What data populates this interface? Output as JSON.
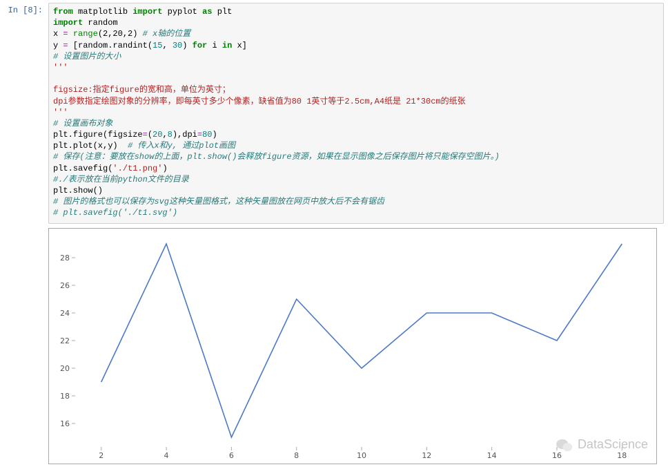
{
  "cell": {
    "prompt": "In  [8]:",
    "code": {
      "l1": {
        "from": "from",
        "mod1": "matplotlib",
        "imp": "import",
        "mod2": "pyplot",
        "as": "as",
        "alias": "plt"
      },
      "l2": {
        "imp": "import",
        "mod": "random"
      },
      "l3": {
        "lhs": "x ",
        "eq": "=",
        "sp": " ",
        "rng": "range",
        "args": "(2,20,2) ",
        "cmt": "# x轴的位置"
      },
      "l4": {
        "lhs": "y ",
        "eq": "=",
        "sp": " [random.randint(",
        "a1": "15",
        "c": ", ",
        "a2": "30",
        "close": ") ",
        "for": "for",
        "sp2": " i ",
        "in": "in",
        "sp3": " x]"
      },
      "l5": "# 设置图片的大小",
      "l6": "'''",
      "l7": "figsize:指定figure的宽和高，单位为英寸；",
      "l8": "dpi参数指定绘图对象的分辨率，即每英寸多少个像素，缺省值为80 1英寸等于2.5cm,A4纸是 21*30cm的纸张",
      "l9": "'''",
      "l10": "# 设置画布对象",
      "l11": {
        "a": "plt.figure(figsize",
        "eq1": "=",
        "b": "(",
        "n1": "20",
        "c1": ",",
        "n2": "8",
        "b2": "),dpi",
        "eq2": "=",
        "n3": "80",
        "b3": ")"
      },
      "l12": {
        "a": "plt.plot(x,y)  ",
        "cmt": "# 传入x和y, 通过plot画图"
      },
      "l13": "# 保存(注意：要放在show的上面，plt.show()会释放figure资源，如果在显示图像之后保存图片将只能保存空图片。)",
      "l14": {
        "a": "plt.savefig(",
        "s": "'./t1.png'",
        "b": ")"
      },
      "l15": "#./表示放在当前python文件的目录",
      "l16": "plt.show()",
      "l17": "# 图片的格式也可以保存为svg这种矢量图格式，这种矢量图放在网页中放大后不会有锯齿",
      "l18": "# plt.savefig('./t1.svg')"
    }
  },
  "chart_data": {
    "type": "line",
    "x": [
      2,
      4,
      6,
      8,
      10,
      12,
      14,
      16,
      18
    ],
    "values": [
      19,
      29,
      15,
      25,
      20,
      24,
      24,
      22,
      29
    ],
    "xlabel": "",
    "ylabel": "",
    "title": "",
    "xlim": [
      1.2,
      18.8
    ],
    "ylim": [
      14.3,
      29.7
    ],
    "xticks": [
      2,
      4,
      6,
      8,
      10,
      12,
      14,
      16,
      18
    ],
    "yticks": [
      16,
      18,
      20,
      22,
      24,
      26,
      28
    ]
  },
  "watermark": "DataScience"
}
